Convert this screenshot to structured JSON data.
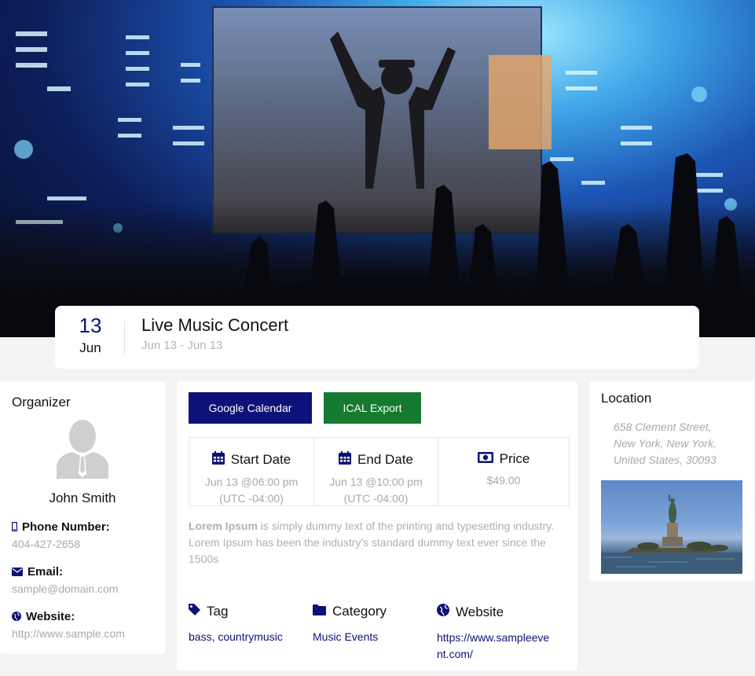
{
  "event": {
    "day": "13",
    "month": "Jun",
    "title": "Live Music Concert",
    "range": "Jun 13 - Jun 13"
  },
  "organizer": {
    "heading": "Organizer",
    "name": "John Smith",
    "phone_label": "Phone Number:",
    "phone": "404-427-2658",
    "email_label": "Email:",
    "email": "sample@domain.com",
    "website_label": "Website:",
    "website": "http://www.sample.com"
  },
  "actions": {
    "google_calendar": "Google Calendar",
    "ical_export": "ICAL Export"
  },
  "info": {
    "start_label": "Start Date",
    "start_value": "Jun 13 @06:00 pm",
    "start_tz": "(UTC -04:00)",
    "end_label": "End Date",
    "end_value": "Jun 13 @10:00 pm",
    "end_tz": "(UTC -04:00)",
    "price_label": "Price",
    "price_value": "$49.00"
  },
  "description": {
    "lead": "Lorem Ipsum",
    "rest": " is simply dummy text of the printing and typesetting industry. Lorem Ipsum has been the industry's standard dummy text ever since the 1500s"
  },
  "meta": {
    "tag_label": "Tag",
    "tag_value": "bass, countrymusic",
    "category_label": "Category",
    "category_value": "Music Events",
    "website_label": "Website",
    "website_value_line1": "https://www.sampleeve",
    "website_value_line2": "nt.com/"
  },
  "location": {
    "heading": "Location",
    "address_line1": "658 Clement Street,",
    "address_line2": "New York, New York,",
    "address_line3": "United States, 30093"
  },
  "colors": {
    "primary": "#0c1277",
    "green": "#157a2f",
    "muted": "#a9a9a9"
  },
  "icons": {
    "phone": "mobile-phone-icon",
    "email": "envelope-icon",
    "website": "globe-icon",
    "calendar": "calendar-icon",
    "price": "money-bill-icon",
    "tag": "tag-icon",
    "category": "folder-icon"
  }
}
